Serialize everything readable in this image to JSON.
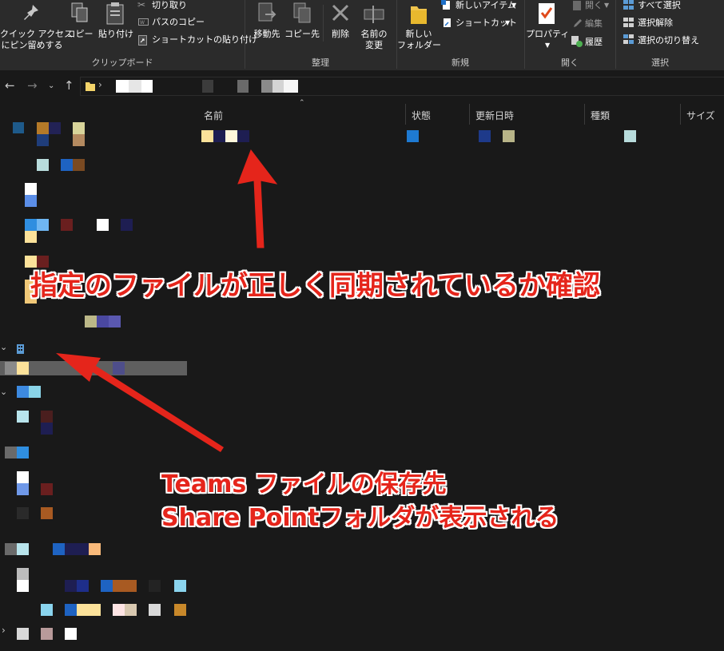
{
  "ribbon": {
    "clipboard": {
      "pin_label_1": "クイック アクセス",
      "pin_label_2": "にピン留めする",
      "copy_label": "コピー",
      "paste_label": "貼り付け",
      "cut_label": "切り取り",
      "copy_path_label": "パスのコピー",
      "paste_shortcut_label": "ショートカットの貼り付け",
      "group_label": "クリップボード"
    },
    "organize": {
      "move_to_label": "移動先",
      "copy_to_label": "コピー先",
      "delete_label": "削除",
      "rename_label_1": "名前の",
      "rename_label_2": "変更",
      "group_label": "整理"
    },
    "new": {
      "new_folder_label_1": "新しい",
      "new_folder_label_2": "フォルダー",
      "new_item_label": "新しいアイテム",
      "shortcut_label": "ショートカット",
      "group_label": "新規"
    },
    "open": {
      "properties_label": "プロパティ",
      "open_label": "開く",
      "edit_label": "編集",
      "history_label": "履歴",
      "group_label": "開く"
    },
    "select": {
      "select_all_label": "すべて選択",
      "select_none_label": "選択解除",
      "invert_label": "選択の切り替え",
      "group_label": "選択"
    }
  },
  "columns": {
    "name": "名前",
    "status": "状態",
    "modified": "更新日時",
    "type": "種類",
    "size": "サイズ"
  },
  "annotations": {
    "top_note": "指定のファイルが正しく同期されているか確認",
    "bottom_note_1": "Teams ファイルの保存先",
    "bottom_note_2": "Share Pointフォルダが表示される"
  },
  "colors": {
    "annotation_red": "#e5251b",
    "background": "#191919",
    "ribbon": "#2b2b2b"
  }
}
